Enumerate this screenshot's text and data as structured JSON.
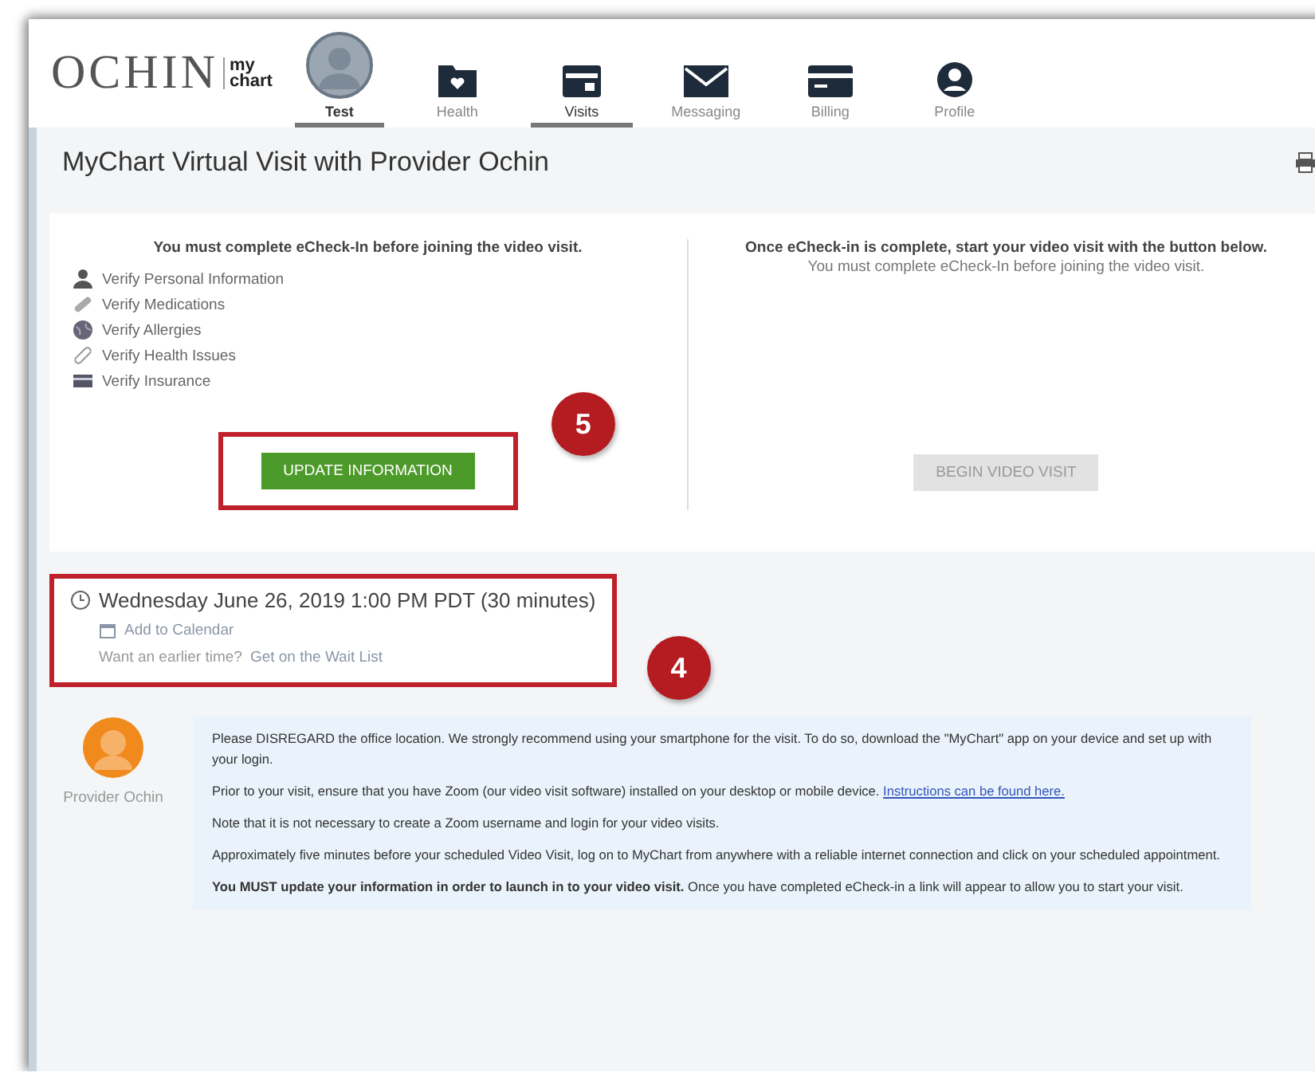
{
  "header": {
    "logo": {
      "main": "OCHIN",
      "top": "my",
      "bottom": "chart"
    },
    "nav": [
      {
        "label": "Test",
        "kind": "avatar",
        "selected": true
      },
      {
        "label": "Health",
        "kind": "icon",
        "selected": false
      },
      {
        "label": "Visits",
        "kind": "icon",
        "selected": true
      },
      {
        "label": "Messaging",
        "kind": "icon",
        "selected": false
      },
      {
        "label": "Billing",
        "kind": "icon",
        "selected": false
      },
      {
        "label": "Profile",
        "kind": "icon",
        "selected": false
      }
    ]
  },
  "page_title": "MyChart Virtual Visit with Provider Ochin",
  "echeckin": {
    "heading": "You must complete eCheck-In before joining the video visit.",
    "items": [
      "Verify Personal Information",
      "Verify Medications",
      "Verify Allergies",
      "Verify Health Issues",
      "Verify Insurance"
    ],
    "button": {
      "label": "UPDATE INFORMATION",
      "disabled": false,
      "annotation": "5"
    }
  },
  "video": {
    "heading": "Once eCheck-in is complete, start your video visit with the button below.",
    "note": "You must complete eCheck-In before joining the video visit.",
    "button": {
      "label": "BEGIN VIDEO VISIT",
      "disabled": true
    }
  },
  "appointment": {
    "when": "Wednesday June 26, 2019 1:00 PM PDT (30 minutes)",
    "calendar_link": "Add to Calendar",
    "waitlist_prompt": "Want an earlier time?",
    "waitlist_link": "Get on the Wait List",
    "annotation": "4"
  },
  "message": {
    "sender": "Provider Ochin",
    "paragraphs": [
      {
        "text": "Please DISREGARD the office location. We strongly recommend using your smartphone for the visit. To do so, download the \"MyChart\" app on your device and set up with your login."
      },
      {
        "text": "Prior to your visit, ensure that you have Zoom (our video visit software) installed on your desktop or mobile device.",
        "link": "Instructions can be found here."
      },
      {
        "text": "Note that it is not necessary to create a Zoom username and login for your video visits."
      },
      {
        "text": "Approximately five minutes before your scheduled Video Visit, log on to MyChart from anywhere with a reliable internet connection and click on your scheduled appointment."
      },
      {
        "text": "**You MUST update your information in order to launch in to your video visit.** Once you have completed eCheck-in a link will appear to allow you to start your visit."
      }
    ]
  }
}
